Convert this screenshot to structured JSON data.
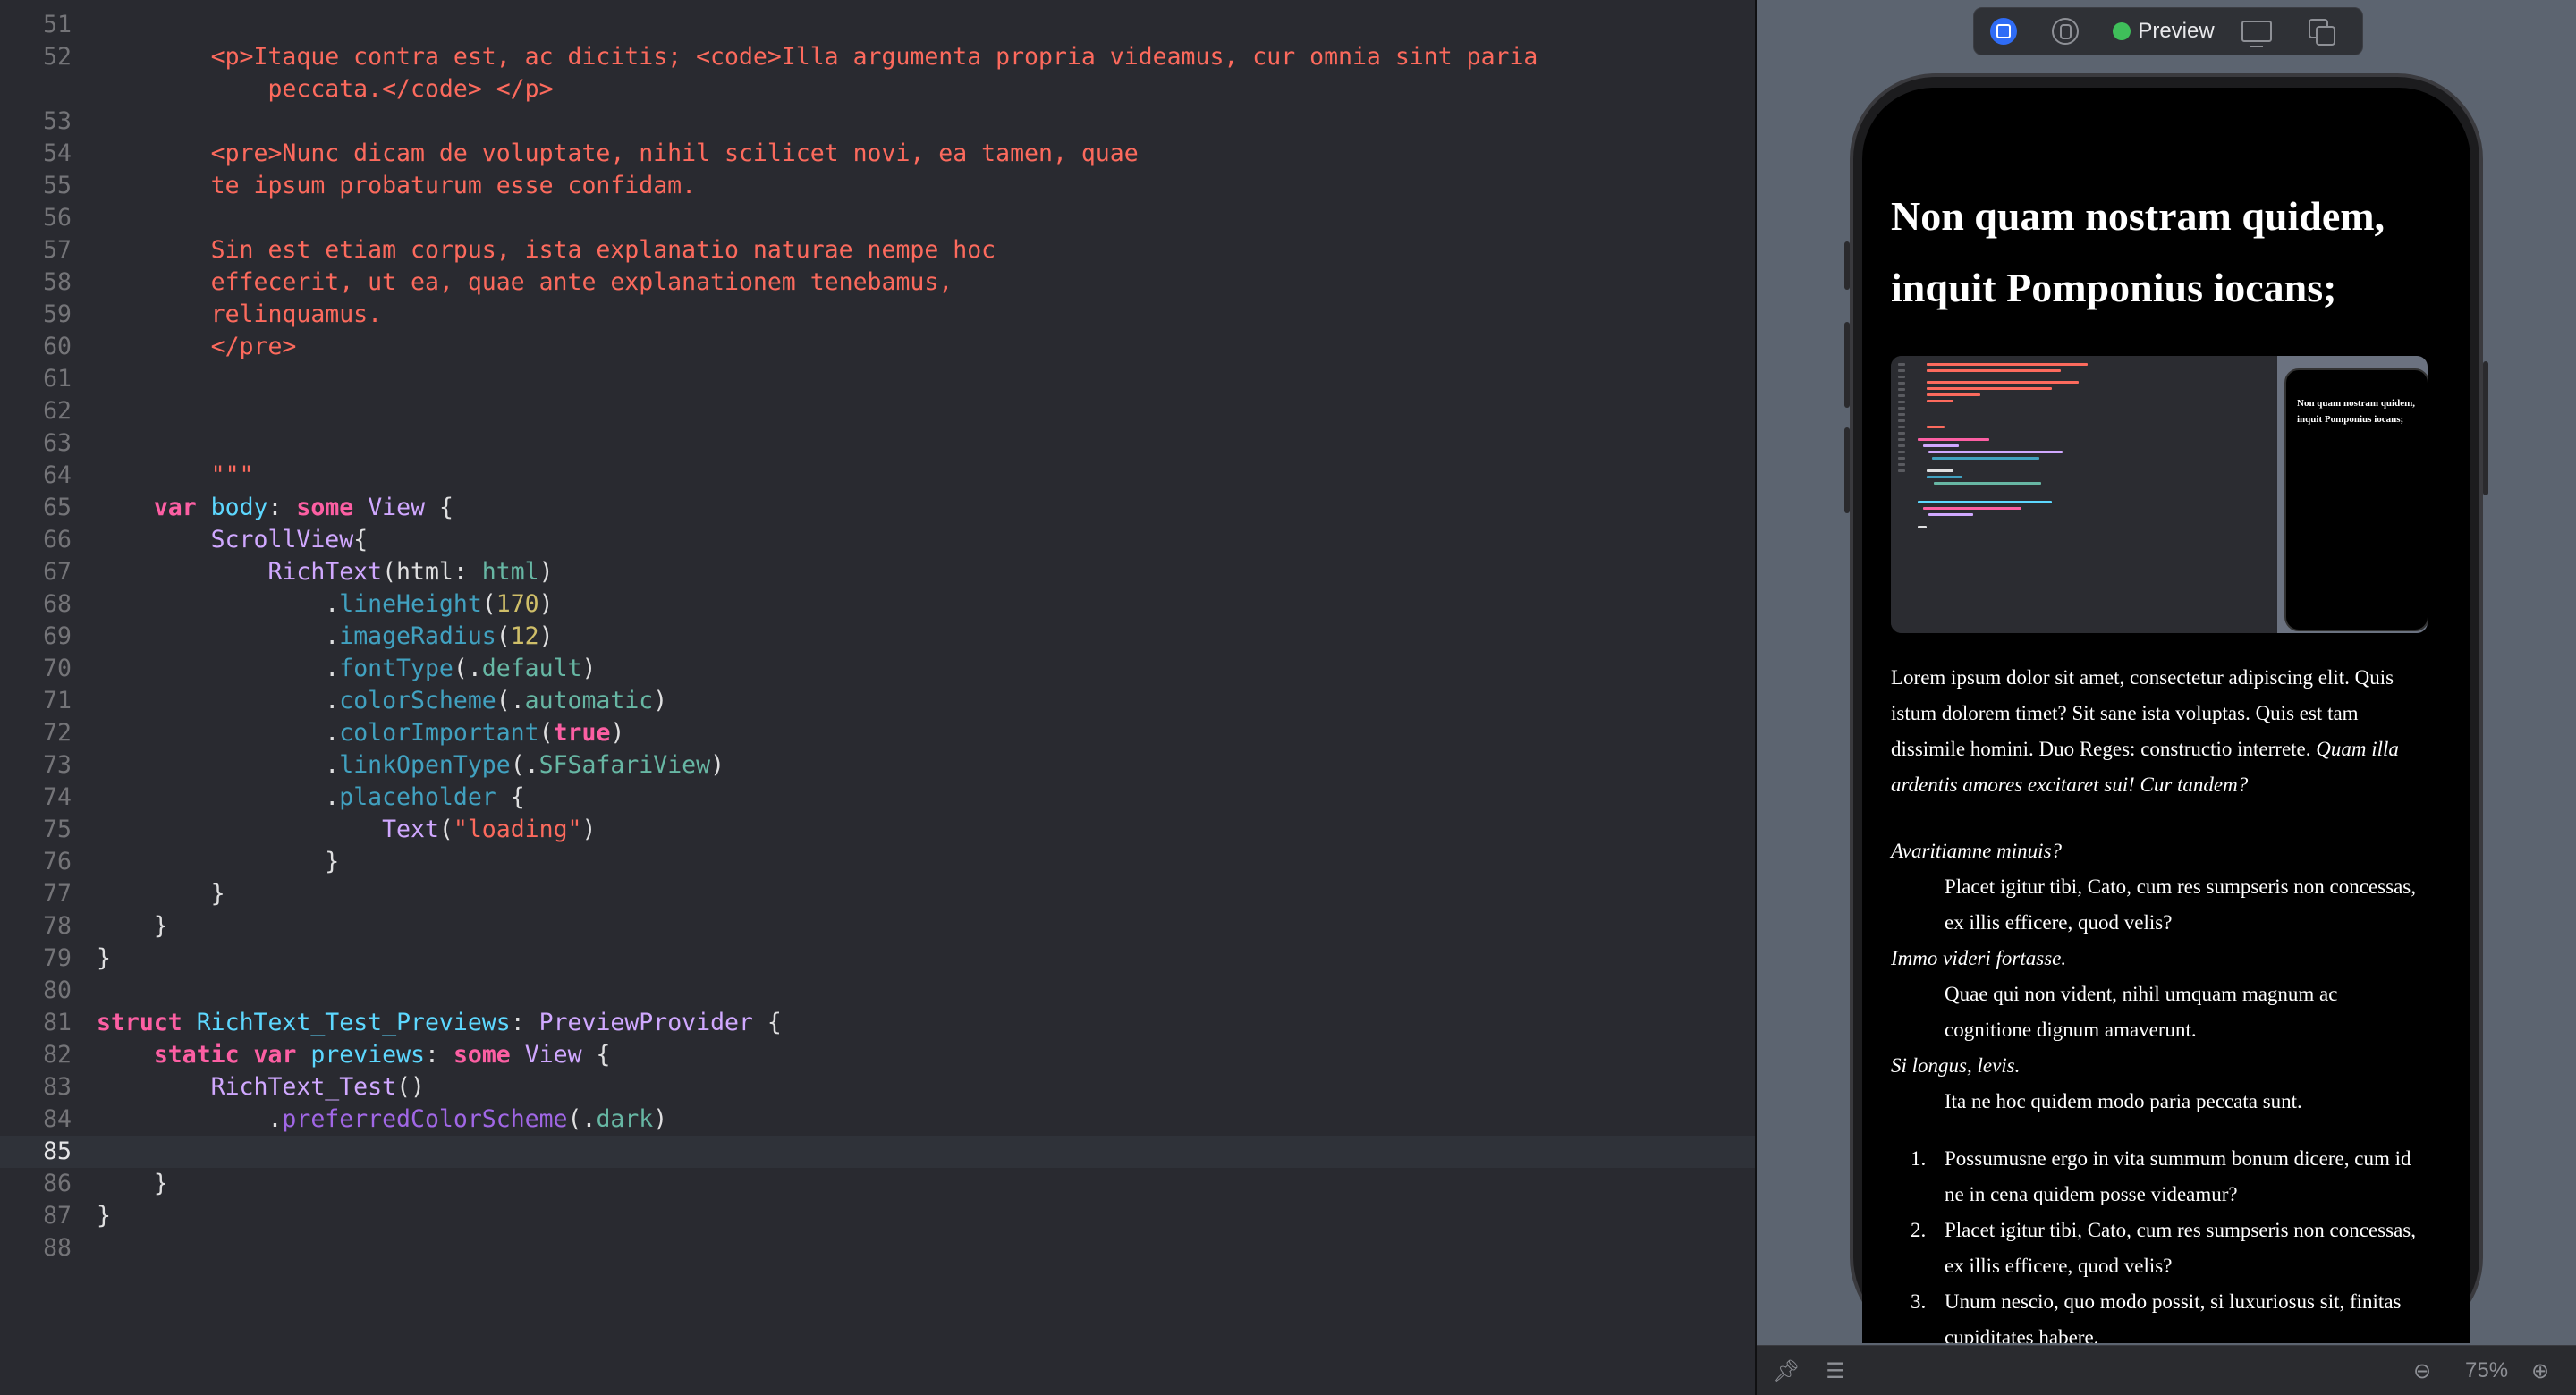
{
  "editor": {
    "lines": [
      {
        "n": "51",
        "tokens": []
      },
      {
        "n": "52",
        "tokens": [
          {
            "t": "        <p>Itaque contra est, ac dicitis; <code>Illa argumenta propria videamus, cur omnia sint paria",
            "c": "t-str"
          }
        ]
      },
      {
        "n": "",
        "tokens": [
          {
            "t": "            peccata.</code> </p>",
            "c": "t-str"
          }
        ]
      },
      {
        "n": "53",
        "tokens": []
      },
      {
        "n": "54",
        "tokens": [
          {
            "t": "        <pre>Nunc dicam de voluptate, nihil scilicet novi, ea tamen, quae",
            "c": "t-str"
          }
        ]
      },
      {
        "n": "55",
        "tokens": [
          {
            "t": "        te ipsum probaturum esse confidam.",
            "c": "t-str"
          }
        ]
      },
      {
        "n": "56",
        "tokens": []
      },
      {
        "n": "57",
        "tokens": [
          {
            "t": "        Sin est etiam corpus, ista explanatio naturae nempe hoc",
            "c": "t-str"
          }
        ]
      },
      {
        "n": "58",
        "tokens": [
          {
            "t": "        effecerit, ut ea, quae ante explanationem tenebamus,",
            "c": "t-str"
          }
        ]
      },
      {
        "n": "59",
        "tokens": [
          {
            "t": "        relinquamus.",
            "c": "t-str"
          }
        ]
      },
      {
        "n": "60",
        "tokens": [
          {
            "t": "        </pre>",
            "c": "t-str"
          }
        ]
      },
      {
        "n": "61",
        "tokens": []
      },
      {
        "n": "62",
        "tokens": []
      },
      {
        "n": "63",
        "tokens": []
      },
      {
        "n": "64",
        "tokens": [
          {
            "t": "        \"\"\"",
            "c": "t-str"
          }
        ]
      },
      {
        "n": "65",
        "tokens": [
          {
            "t": "    ",
            "c": "t-plain"
          },
          {
            "t": "var",
            "c": "t-kw"
          },
          {
            "t": " ",
            "c": "t-plain"
          },
          {
            "t": "body",
            "c": "t-typedecl"
          },
          {
            "t": ": ",
            "c": "t-plain"
          },
          {
            "t": "some",
            "c": "t-kw"
          },
          {
            "t": " ",
            "c": "t-plain"
          },
          {
            "t": "View",
            "c": "t-type"
          },
          {
            "t": " {",
            "c": "t-plain"
          }
        ]
      },
      {
        "n": "66",
        "tokens": [
          {
            "t": "        ",
            "c": "t-plain"
          },
          {
            "t": "ScrollView",
            "c": "t-type"
          },
          {
            "t": "{",
            "c": "t-plain"
          }
        ]
      },
      {
        "n": "67",
        "tokens": [
          {
            "t": "            ",
            "c": "t-plain"
          },
          {
            "t": "RichText",
            "c": "t-type"
          },
          {
            "t": "(html: ",
            "c": "t-plain"
          },
          {
            "t": "html",
            "c": "t-var"
          },
          {
            "t": ")",
            "c": "t-plain"
          }
        ]
      },
      {
        "n": "68",
        "tokens": [
          {
            "t": "                .",
            "c": "t-plain"
          },
          {
            "t": "lineHeight",
            "c": "t-def"
          },
          {
            "t": "(",
            "c": "t-plain"
          },
          {
            "t": "170",
            "c": "t-num"
          },
          {
            "t": ")",
            "c": "t-plain"
          }
        ]
      },
      {
        "n": "69",
        "tokens": [
          {
            "t": "                .",
            "c": "t-plain"
          },
          {
            "t": "imageRadius",
            "c": "t-def"
          },
          {
            "t": "(",
            "c": "t-plain"
          },
          {
            "t": "12",
            "c": "t-num"
          },
          {
            "t": ")",
            "c": "t-plain"
          }
        ]
      },
      {
        "n": "70",
        "tokens": [
          {
            "t": "                .",
            "c": "t-plain"
          },
          {
            "t": "fontType",
            "c": "t-def"
          },
          {
            "t": "(.",
            "c": "t-plain"
          },
          {
            "t": "default",
            "c": "t-var"
          },
          {
            "t": ")",
            "c": "t-plain"
          }
        ]
      },
      {
        "n": "71",
        "tokens": [
          {
            "t": "                .",
            "c": "t-plain"
          },
          {
            "t": "colorScheme",
            "c": "t-def"
          },
          {
            "t": "(.",
            "c": "t-plain"
          },
          {
            "t": "automatic",
            "c": "t-var"
          },
          {
            "t": ")",
            "c": "t-plain"
          }
        ]
      },
      {
        "n": "72",
        "tokens": [
          {
            "t": "                .",
            "c": "t-plain"
          },
          {
            "t": "colorImportant",
            "c": "t-def"
          },
          {
            "t": "(",
            "c": "t-plain"
          },
          {
            "t": "true",
            "c": "t-kw"
          },
          {
            "t": ")",
            "c": "t-plain"
          }
        ]
      },
      {
        "n": "73",
        "tokens": [
          {
            "t": "                .",
            "c": "t-plain"
          },
          {
            "t": "linkOpenType",
            "c": "t-def"
          },
          {
            "t": "(.",
            "c": "t-plain"
          },
          {
            "t": "SFSafariView",
            "c": "t-var"
          },
          {
            "t": ")",
            "c": "t-plain"
          }
        ]
      },
      {
        "n": "74",
        "tokens": [
          {
            "t": "                .",
            "c": "t-plain"
          },
          {
            "t": "placeholder",
            "c": "t-def"
          },
          {
            "t": " {",
            "c": "t-plain"
          }
        ]
      },
      {
        "n": "75",
        "tokens": [
          {
            "t": "                    ",
            "c": "t-plain"
          },
          {
            "t": "Text",
            "c": "t-type"
          },
          {
            "t": "(",
            "c": "t-plain"
          },
          {
            "t": "\"loading\"",
            "c": "t-str"
          },
          {
            "t": ")",
            "c": "t-plain"
          }
        ]
      },
      {
        "n": "76",
        "tokens": [
          {
            "t": "                }",
            "c": "t-plain"
          }
        ]
      },
      {
        "n": "77",
        "tokens": [
          {
            "t": "        }",
            "c": "t-plain"
          }
        ]
      },
      {
        "n": "78",
        "tokens": [
          {
            "t": "    }",
            "c": "t-plain"
          }
        ]
      },
      {
        "n": "79",
        "tokens": [
          {
            "t": "}",
            "c": "t-plain"
          }
        ]
      },
      {
        "n": "80",
        "tokens": []
      },
      {
        "n": "81",
        "tokens": [
          {
            "t": "struct",
            "c": "t-kw"
          },
          {
            "t": " ",
            "c": "t-plain"
          },
          {
            "t": "RichText_Test_Previews",
            "c": "t-typedecl"
          },
          {
            "t": ": ",
            "c": "t-plain"
          },
          {
            "t": "PreviewProvider",
            "c": "t-type"
          },
          {
            "t": " {",
            "c": "t-plain"
          }
        ]
      },
      {
        "n": "82",
        "tokens": [
          {
            "t": "    ",
            "c": "t-plain"
          },
          {
            "t": "static",
            "c": "t-kw"
          },
          {
            "t": " ",
            "c": "t-plain"
          },
          {
            "t": "var",
            "c": "t-kw"
          },
          {
            "t": " ",
            "c": "t-plain"
          },
          {
            "t": "previews",
            "c": "t-typedecl"
          },
          {
            "t": ": ",
            "c": "t-plain"
          },
          {
            "t": "some",
            "c": "t-kw"
          },
          {
            "t": " ",
            "c": "t-plain"
          },
          {
            "t": "View",
            "c": "t-type"
          },
          {
            "t": " {",
            "c": "t-plain"
          }
        ]
      },
      {
        "n": "83",
        "tokens": [
          {
            "t": "        ",
            "c": "t-plain"
          },
          {
            "t": "RichText_Test",
            "c": "t-type"
          },
          {
            "t": "()",
            "c": "t-plain"
          }
        ]
      },
      {
        "n": "84",
        "tokens": [
          {
            "t": "            .",
            "c": "t-plain"
          },
          {
            "t": "preferredColorScheme",
            "c": "t-meth"
          },
          {
            "t": "(.",
            "c": "t-plain"
          },
          {
            "t": "dark",
            "c": "t-var"
          },
          {
            "t": ")",
            "c": "t-plain"
          }
        ]
      },
      {
        "n": "85",
        "tokens": [],
        "current": true
      },
      {
        "n": "86",
        "tokens": [
          {
            "t": "    }",
            "c": "t-plain"
          }
        ]
      },
      {
        "n": "87",
        "tokens": [
          {
            "t": "}",
            "c": "t-plain"
          }
        ]
      },
      {
        "n": "88",
        "tokens": []
      }
    ]
  },
  "canvas": {
    "toolbar": {
      "live_icon": "live-mode-icon",
      "select_icon": "selectable-mode-icon",
      "preview_label": "Preview",
      "device_icon": "device-settings-icon",
      "duplicate_icon": "duplicate-preview-icon"
    },
    "preview": {
      "title": "Non quam nostram quidem, inquit Pomponius iocans;",
      "thumbnail_title": "Non quam nostram quidem, inquit Pomponius iocans;",
      "paragraph": "Lorem ipsum dolor sit amet, consectetur adipiscing elit. Quis istum dolorem timet? Sit sane ista voluptas. Quis est tam dissimile homini. Duo Reges: constructio interrete.",
      "paragraph_italic": "Quam illa ardentis amores excitaret sui! Cur tandem?",
      "dl": [
        {
          "term": "Avaritiamne minuis?",
          "desc": "Placet igitur tibi, Cato, cum res sumpseris non concessas, ex illis efficere, quod velis?"
        },
        {
          "term": "Immo videri fortasse.",
          "desc": "Quae qui non vident, nihil umquam magnum ac cognitione dignum amaverunt."
        },
        {
          "term": "Si longus, levis.",
          "desc": "Ita ne hoc quidem modo paria peccata sunt."
        }
      ],
      "ol": [
        {
          "num": "1.",
          "text": "Possumusne ergo in vita summum bonum dicere, cum id ne in cena quidem posse videamur?"
        },
        {
          "num": "2.",
          "text": "Placet igitur tibi, Cato, cum res sumpseris non concessas, ex illis efficere, quod velis?"
        },
        {
          "num": "3.",
          "text": "Unum nescio, quo modo possit, si luxuriosus sit, finitas cupiditates habere."
        }
      ]
    },
    "bottombar": {
      "pin_icon": "pin-icon",
      "variants_icon": "variants-icon",
      "zoom_out_icon": "zoom-out-icon",
      "zoom_level": "75%",
      "zoom_in_icon": "zoom-in-icon"
    }
  },
  "colors": {
    "editor_bg": "#292a30",
    "string": "#fc6a5d",
    "keyword": "#fc5fa3",
    "type": "#d0a8ff",
    "declaration": "#5dd8ff",
    "number": "#d0bf69",
    "accent": "#2f6cf6",
    "live_green": "#3fbf5a"
  }
}
